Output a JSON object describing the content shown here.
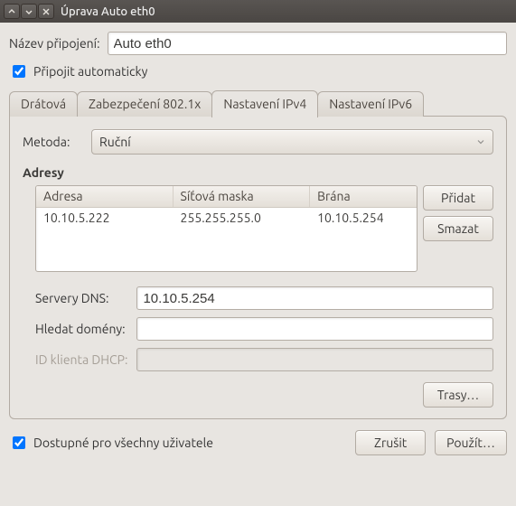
{
  "titlebar": {
    "title": "Úprava Auto eth0"
  },
  "connection_name": {
    "label": "Název připojení:",
    "value": "Auto eth0"
  },
  "auto_connect": {
    "label": "Připojit automaticky",
    "checked": true
  },
  "tabs": [
    {
      "id": "wired",
      "label": "Drátová",
      "active": false
    },
    {
      "id": "sec1x",
      "label": "Zabezpečení 802.1x",
      "active": false
    },
    {
      "id": "ipv4",
      "label": "Nastavení IPv4",
      "active": true
    },
    {
      "id": "ipv6",
      "label": "Nastavení IPv6",
      "active": false
    }
  ],
  "ipv4": {
    "method_label": "Metoda:",
    "method_value": "Ruční",
    "addresses_heading": "Adresy",
    "columns": {
      "address": "Adresa",
      "netmask": "Síťová maska",
      "gateway": "Brána"
    },
    "rows": [
      {
        "address": "10.10.5.222",
        "netmask": "255.255.255.0",
        "gateway": "10.10.5.254"
      }
    ],
    "buttons": {
      "add": "Přidat",
      "delete": "Smazat",
      "routes": "Trasy…"
    },
    "dns": {
      "label": "Servery DNS:",
      "value": "10.10.5.254"
    },
    "search_domains": {
      "label": "Hledat domény:",
      "value": ""
    },
    "dhcp_client_id": {
      "label": "ID klienta DHCP:",
      "value": "",
      "disabled": true
    }
  },
  "footer": {
    "all_users_label": "Dostupné pro všechny uživatele",
    "all_users_checked": true,
    "cancel": "Zrušit",
    "apply": "Použít…"
  }
}
